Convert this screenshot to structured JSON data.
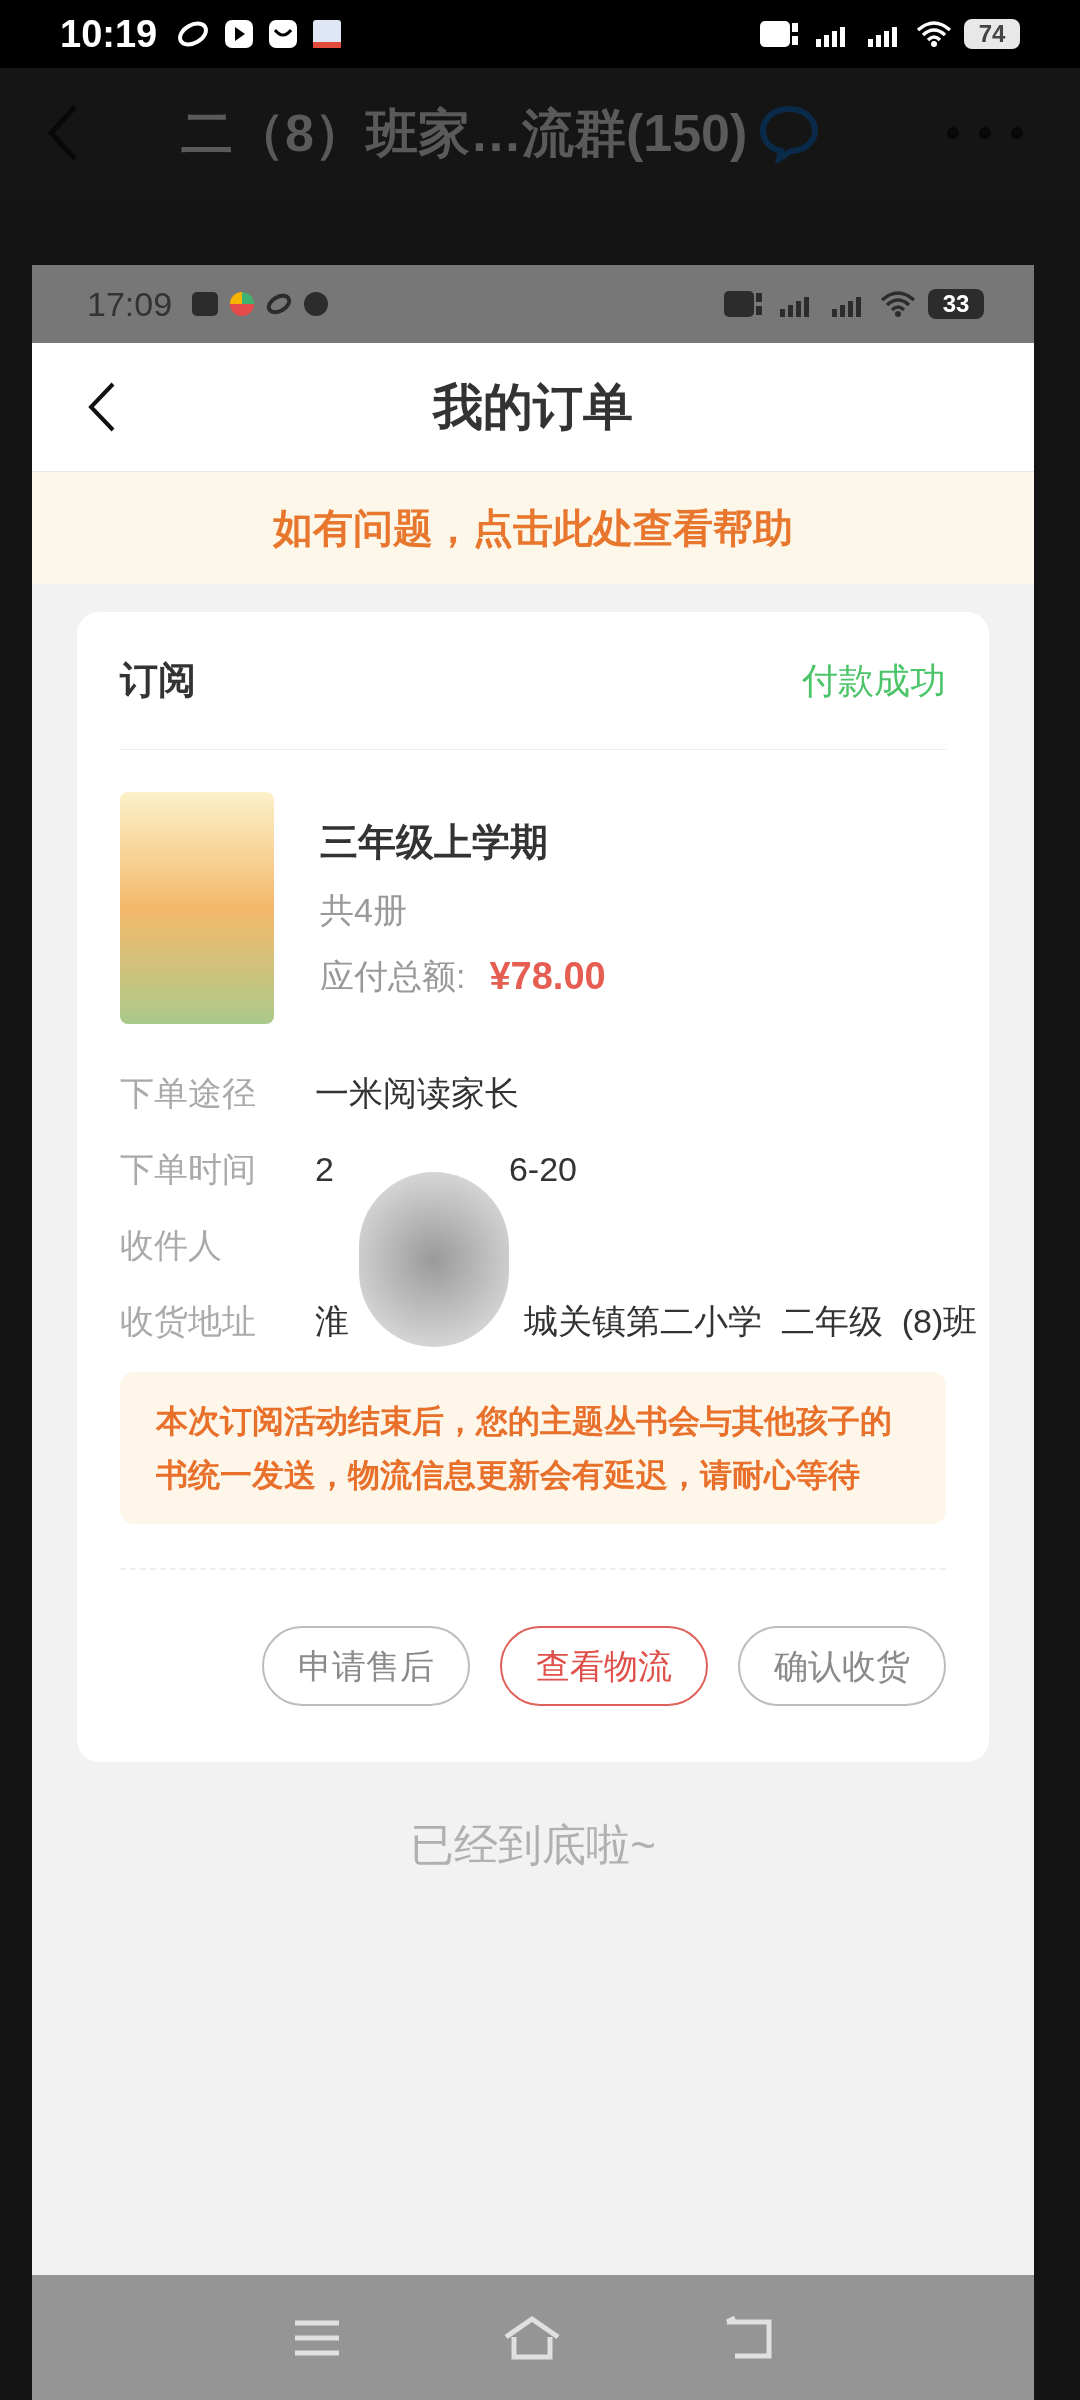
{
  "status_bar": {
    "time": "10:19",
    "battery": "74"
  },
  "background_chat": {
    "title": "二（8）班家…流群(150)"
  },
  "inner_status_bar": {
    "time": "17:09",
    "battery": "33"
  },
  "header": {
    "title": "我的订单"
  },
  "help_banner": "如有问题，点击此处查看帮助",
  "order": {
    "type": "订阅",
    "status": "付款成功",
    "product": {
      "title": "三年级上学期",
      "count": "共4册",
      "total_label": "应付总额:",
      "total": "¥78.00"
    },
    "details": [
      {
        "label": "下单途径",
        "value_parts": [
          "一米阅读家长"
        ]
      },
      {
        "label": "下单时间",
        "value_parts": [
          "2",
          "6-20"
        ]
      },
      {
        "label": "收件人"
      },
      {
        "label": "收货地址",
        "value_parts": [
          "淮",
          "城关镇第二小学  二年级  (8)班"
        ]
      }
    ],
    "notice": "本次订阅活动结束后，您的主题丛书会与其他孩子的书统一发送，物流信息更新会有延迟，请耐心等待",
    "actions": [
      {
        "label": "申请售后",
        "kind": "plain"
      },
      {
        "label": "查看物流",
        "kind": "primary"
      },
      {
        "label": "确认收货",
        "kind": "plain"
      }
    ]
  },
  "end_text": "已经到底啦~"
}
